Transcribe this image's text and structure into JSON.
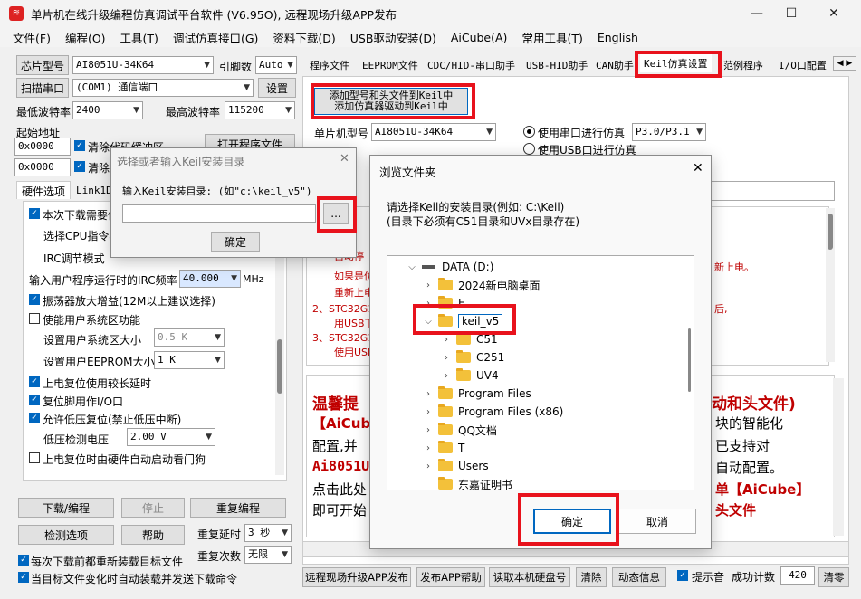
{
  "window": {
    "title": "单片机在线升级编程仿真调试平台软件 (V6.95O), 远程现场升级APP发布",
    "minimize": "—",
    "maximize": "☐",
    "close": "✕"
  },
  "menu": [
    "文件(F)",
    "编程(O)",
    "工具(T)",
    "调试仿真接口(G)",
    "资料下载(D)",
    "USB驱动安装(D)",
    "AiCube(A)",
    "常用工具(T)",
    "English"
  ],
  "left": {
    "chip_btn": "芯片型号",
    "chip_value": "AI8051U-34K64",
    "pins_label": "引脚数",
    "pins_value": "Auto",
    "scan_btn": "扫描串口",
    "port_value": "(COM1) 通信端口",
    "settings_btn": "设置",
    "min_baud_label": "最低波特率",
    "min_baud_value": "2400",
    "max_baud_label": "最高波特率",
    "max_baud_value": "115200",
    "start_addr_label": "起始地址",
    "addr1": "0x0000",
    "addr2": "0x0000",
    "clear_code_label": "清除代码缓冲区",
    "clear_eeprom_label": "清除EEPROM缓冲区",
    "open_file_btn": "打开程序文件",
    "tabs": [
      "硬件选项",
      "Link1D"
    ],
    "opt_reset_label": "本次下载需要修改硬件选项",
    "cpu_label": "选择CPU指令模式",
    "irc_label": "IRC调节模式",
    "irc_freq_label": "输入用户程序运行时的IRC频率",
    "irc_freq_value": "40.000",
    "mhz": "MHz",
    "osc_label": "振荡器放大增益(12M以上建议选择)",
    "sys_area_label": "使能用户系统区功能",
    "sys_size_label": "设置用户系统区大小",
    "sys_size_value": "0.5 K",
    "eeprom_size_label": "设置用户EEPROM大小",
    "eeprom_size_value": "1 K",
    "reset_long_label": "上电复位使用较长延时",
    "reset_io_label": "复位脚用作I/O口",
    "lowv_label": "允许低压复位(禁止低压中断)",
    "lowv_level_label": "低压检测电压",
    "lowv_level_value": "2.00 V",
    "wdt_label": "上电复位时由硬件自动启动看门狗",
    "download_btn": "下载/编程",
    "stop_btn": "停止",
    "reprog_btn": "重复编程",
    "check_btn": "检测选项",
    "help_btn": "帮助",
    "repeat_delay_label": "重复延时",
    "repeat_delay_value": "3 秒",
    "repeat_count_label": "重复次数",
    "repeat_count_value": "无限",
    "reload_label": "每次下载前都重新装载目标文件",
    "autosend_label": "当目标文件变化时自动装载并发送下载命令"
  },
  "right": {
    "tabs": [
      "程序文件",
      "EEPROM文件",
      "CDC/HID-串口助手",
      "USB-HID助手",
      "CAN助手",
      "Keil仿真设置",
      "范例程序",
      "I/O口配置"
    ],
    "add_btn_line1": "添加型号和头文件到Keil中",
    "add_btn_line2": "添加仿真器驱动到Keil中",
    "mcu_label": "单片机型号",
    "mcu_value": "AI8051U-34K64",
    "serial_sim_label": "使用串口进行仿真",
    "serial_port_value": "P3.0/P3.1",
    "usb_sim_label": "使用USB口进行仿真",
    "notes": [
      "自动停",
      "如果是仿",
      "重新上电",
      "2、STC32G1",
      "用USB下",
      "3、STC32G1",
      "使用USB"
    ],
    "notes_right": [
      "新上电。",
      "后,"
    ],
    "tips_title": "温馨提",
    "tips_title_right": "动和头文件)",
    "tips_l1": "【AiCube",
    "tips_l1r": "块的智能化",
    "tips_l2": "配置,并",
    "tips_l2r": "已支持对",
    "tips_l3": "Ai8051U",
    "tips_l3r": "自动配置。",
    "tips_l4": "点击此处",
    "tips_l4r": "单【AiCube】",
    "tips_l5": "即可开始",
    "tips_l5r": "头文件"
  },
  "bottom": {
    "publish_btn": "远程现场升级APP发布",
    "publish_help_btn": "发布APP帮助",
    "read_disk_btn": "读取本机硬盘号",
    "clear_btn": "清除",
    "anim_btn": "动态信息",
    "beep_label": "提示音",
    "success_label": "成功计数",
    "success_value": "420",
    "clear2_btn": "清零"
  },
  "keil_dialog": {
    "title": "选择或者输入Keil安装目录",
    "prompt": "输入Keil安装目录: (如\"c:\\keil_v5\")",
    "browse_btn": "...",
    "ok_btn": "确定",
    "path_value": ""
  },
  "browse_dialog": {
    "title": "浏览文件夹",
    "desc1": "请选择Keil的安装目录(例如: C:\\Keil)",
    "desc2": "(目录下必须有C51目录和UVx目录存在)",
    "drive": "DATA (D:)",
    "items": [
      "2024新电脑桌面",
      "E",
      "keil_v5",
      "C51",
      "C251",
      "UV4",
      "Program Files",
      "Program Files (x86)",
      "QQ文档",
      "T",
      "Users",
      "东嘉证明书"
    ],
    "ok_btn": "确定",
    "cancel_btn": "取消"
  },
  "colors": {
    "highlight": "#e8121c",
    "accent": "#0067c0",
    "note_red": "#c00000"
  }
}
